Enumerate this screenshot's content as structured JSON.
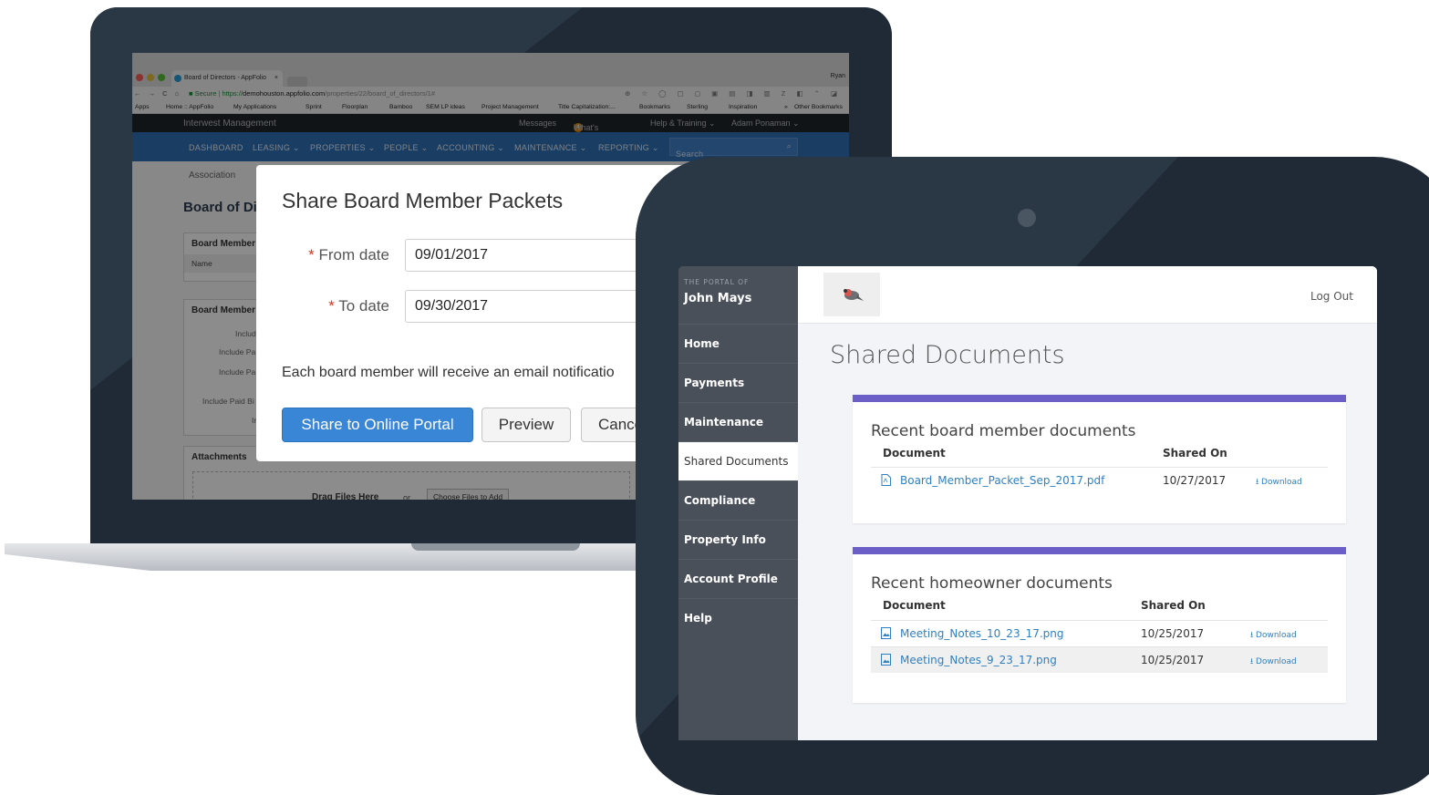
{
  "colors": {
    "device_frame": "#1f2a36",
    "app_nav_blue": "#2f6fb5",
    "primary_button": "#3a86d6",
    "card_accent": "#6b5fc7",
    "link": "#2f7fc1",
    "required": "#d9341f"
  },
  "browser": {
    "tab_title": "Board of Directors - AppFolio",
    "tab_close": "×",
    "profile": "Ryan",
    "nav_icons": "← → C ⌂",
    "url_secure": "Secure",
    "url_prefix": "https://",
    "url_host": "demohouston.appfolio.com",
    "url_path": "/properties/22/board_of_directors/1#",
    "extension_icons": "⊕ ☆ ◯ ▢ ◻ ▣ ▤ ◨ ▥ Z ◧ ⌃ ◪",
    "bookmarks": [
      "Apps",
      "Home :: AppFolio",
      "My Applications",
      "Sprint",
      "Floorplan",
      "Bamboo",
      "SEM LP ideas",
      "Project Management",
      "Title Capitalization:...",
      "Bookmarks",
      "Sterling",
      "Inspiration",
      "»",
      "Other Bookmarks"
    ]
  },
  "app": {
    "company": "Interwest Management",
    "top_links": {
      "messages": "Messages",
      "badge": "4",
      "whats_new": "What's New",
      "help": "Help & Training ⌄",
      "user": "Adam Ponaman ⌄"
    },
    "nav": [
      "DASHBOARD",
      "LEASING ⌄",
      "PROPERTIES ⌄",
      "PEOPLE ⌄",
      "ACCOUNTING ⌄",
      "MAINTENANCE ⌄",
      "REPORTING ⌄"
    ],
    "search_placeholder": "Search",
    "search_icon": "⌕",
    "subtab": "Association",
    "page_title": "Board of Di",
    "panel1_title": "Board Member",
    "panel1_col": "Name",
    "panel2_title": "Board Member",
    "panel2_labels": [
      "Include",
      "Include Pa",
      "Include Pa",
      "Include Paid Bi",
      "In"
    ],
    "attachments_title": "Attachments",
    "drag_text": "Drag Files Here",
    "drag_or": "or",
    "choose_files": "Choose Files to Add"
  },
  "modal": {
    "title": "Share Board Member Packets",
    "required_mark": "*",
    "from_label": "From date",
    "from_value": "09/01/2017",
    "to_label": "To date",
    "to_value": "09/30/2017",
    "message": "Each board member will receive an email notificatio",
    "share_button": "Share to Online Portal",
    "preview_button": "Preview",
    "cancel_button": "Cance"
  },
  "portal": {
    "brand_small": "THE PORTAL OF",
    "brand_name": "John Mays",
    "logout": "Log Out",
    "sidebar": [
      "Home",
      "Payments",
      "Maintenance",
      "Shared Documents",
      "Compliance",
      "Property Info",
      "Account Profile",
      "Help"
    ],
    "active_item": "Shared Documents",
    "page_title": "Shared Documents",
    "sections": [
      {
        "title": "Recent board member documents",
        "col_document": "Document",
        "col_shared": "Shared On",
        "rows": [
          {
            "name": "Board_Member_Packet_Sep_2017.pdf",
            "date": "10/27/2017",
            "action": "Download",
            "icon": "pdf-icon"
          }
        ]
      },
      {
        "title": "Recent homeowner documents",
        "col_document": "Document",
        "col_shared": "Shared On",
        "rows": [
          {
            "name": "Meeting_Notes_10_23_17.png",
            "date": "10/25/2017",
            "action": "Download",
            "icon": "image-file-icon"
          },
          {
            "name": "Meeting_Notes_9_23_17.png",
            "date": "10/25/2017",
            "action": "Download",
            "icon": "image-file-icon"
          }
        ]
      }
    ]
  }
}
